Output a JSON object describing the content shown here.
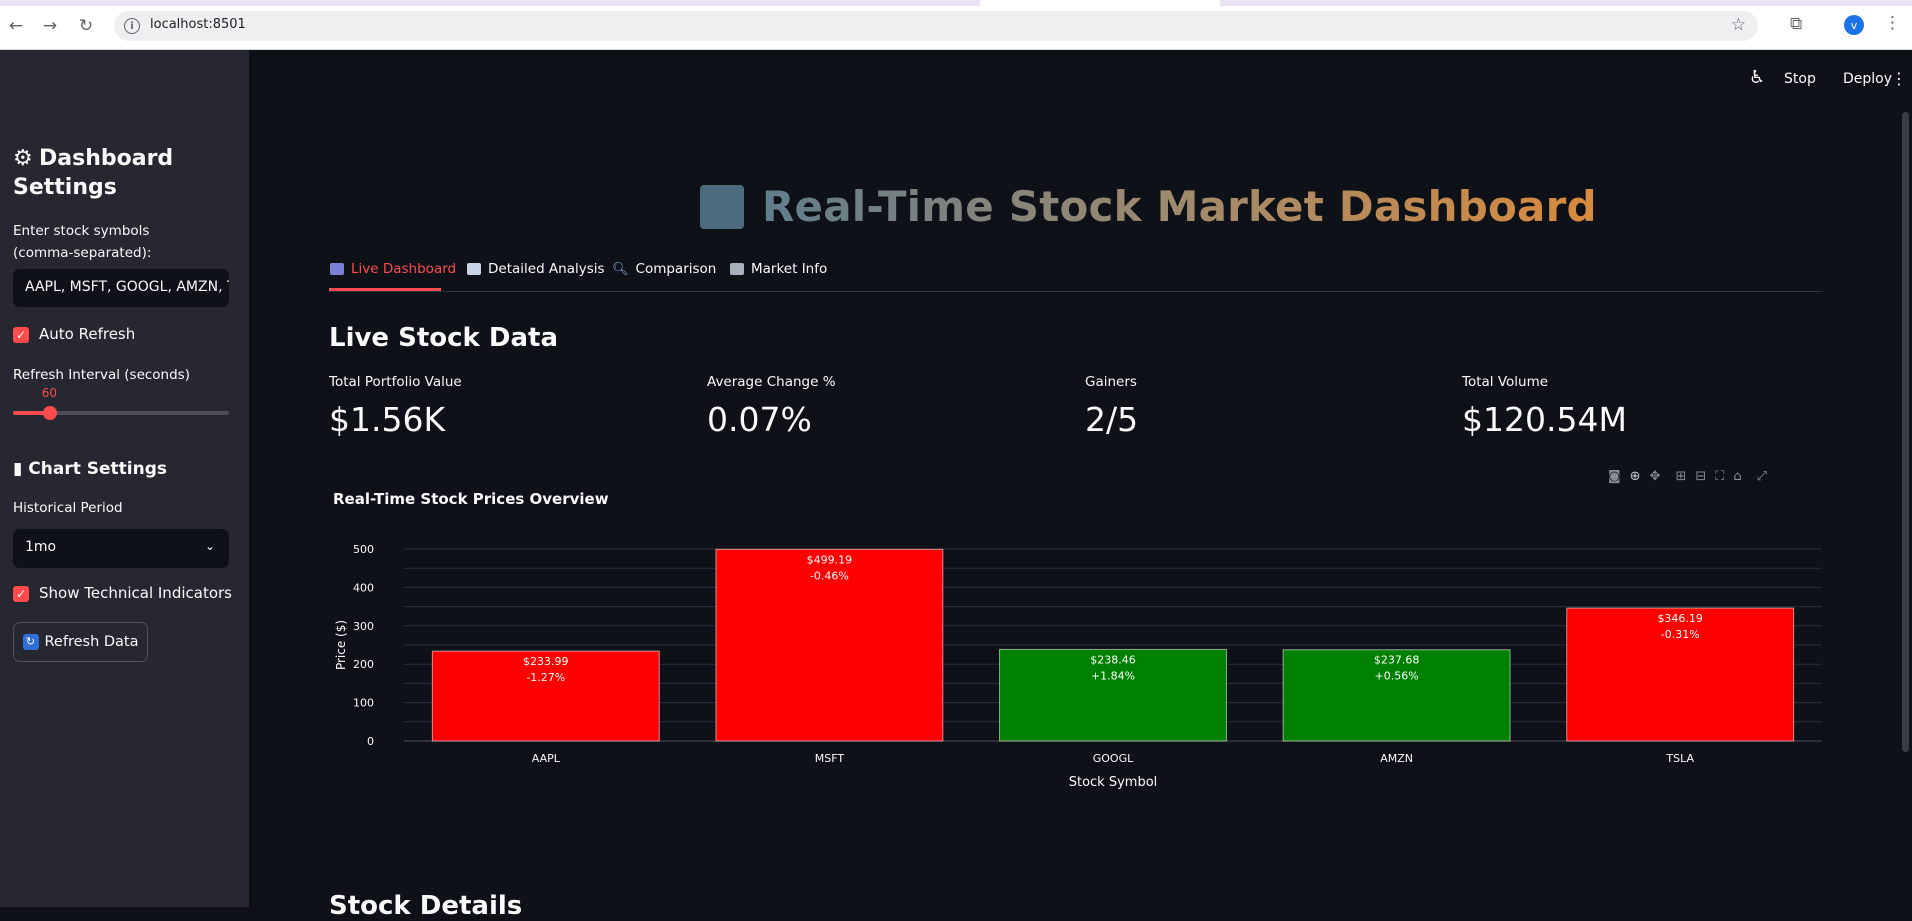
{
  "browser": {
    "url": "localhost:8501",
    "profile_initial": "v"
  },
  "app_header": {
    "stop_label": "Stop",
    "deploy_label": "Deploy"
  },
  "sidebar": {
    "title": "Dashboard Settings",
    "symbols_label": "Enter stock symbols (comma-separated):",
    "symbols_value": "AAPL, MSFT, GOOGL, AMZN, TSLA",
    "auto_refresh_label": "Auto Refresh",
    "auto_refresh_checked": true,
    "refresh_interval_label": "Refresh Interval (seconds)",
    "refresh_interval_value": "60",
    "refresh_interval_fraction": 0.17,
    "chart_settings_title": "Chart Settings",
    "historical_period_label": "Historical Period",
    "historical_period_value": "1mo",
    "technical_indicators_label": "Show Technical Indicators",
    "technical_indicators_checked": true,
    "refresh_button_label": "Refresh Data"
  },
  "main": {
    "title": "Real-Time Stock Market Dashboard",
    "tabs": [
      {
        "label": "Live Dashboard",
        "active": true
      },
      {
        "label": "Detailed Analysis",
        "active": false
      },
      {
        "label": "Comparison",
        "active": false
      },
      {
        "label": "Market Info",
        "active": false
      }
    ],
    "live_heading": "Live Stock Data",
    "metrics": [
      {
        "label": "Total Portfolio Value",
        "value": "$1.56K"
      },
      {
        "label": "Average Change %",
        "value": "0.07%"
      },
      {
        "label": "Gainers",
        "value": "2/5"
      },
      {
        "label": "Total Volume",
        "value": "$120.54M"
      }
    ],
    "details_heading": "Stock Details"
  },
  "colors": {
    "accent": "#ff4b4b",
    "gain": "#008000",
    "loss": "#ff0000",
    "background": "#0e1117",
    "sidebar": "#262730"
  },
  "chart_data": {
    "type": "bar",
    "title": "Real-Time Stock Prices Overview",
    "xlabel": "Stock Symbol",
    "ylabel": "Price ($)",
    "categories": [
      "AAPL",
      "MSFT",
      "GOOGL",
      "AMZN",
      "TSLA"
    ],
    "values": [
      233.99,
      499.19,
      238.46,
      237.68,
      346.19
    ],
    "changes": [
      "-1.27%",
      "-0.46%",
      "+1.84%",
      "+0.56%",
      "-0.31%"
    ],
    "labels": [
      "$233.99",
      "$499.19",
      "$238.46",
      "$237.68",
      "$346.19"
    ],
    "colors": [
      "#ff0000",
      "#ff0000",
      "#008000",
      "#008000",
      "#ff0000"
    ],
    "yticks": [
      0,
      100,
      200,
      300,
      400,
      500
    ],
    "ylim": [
      0,
      525
    ],
    "grid": true
  }
}
